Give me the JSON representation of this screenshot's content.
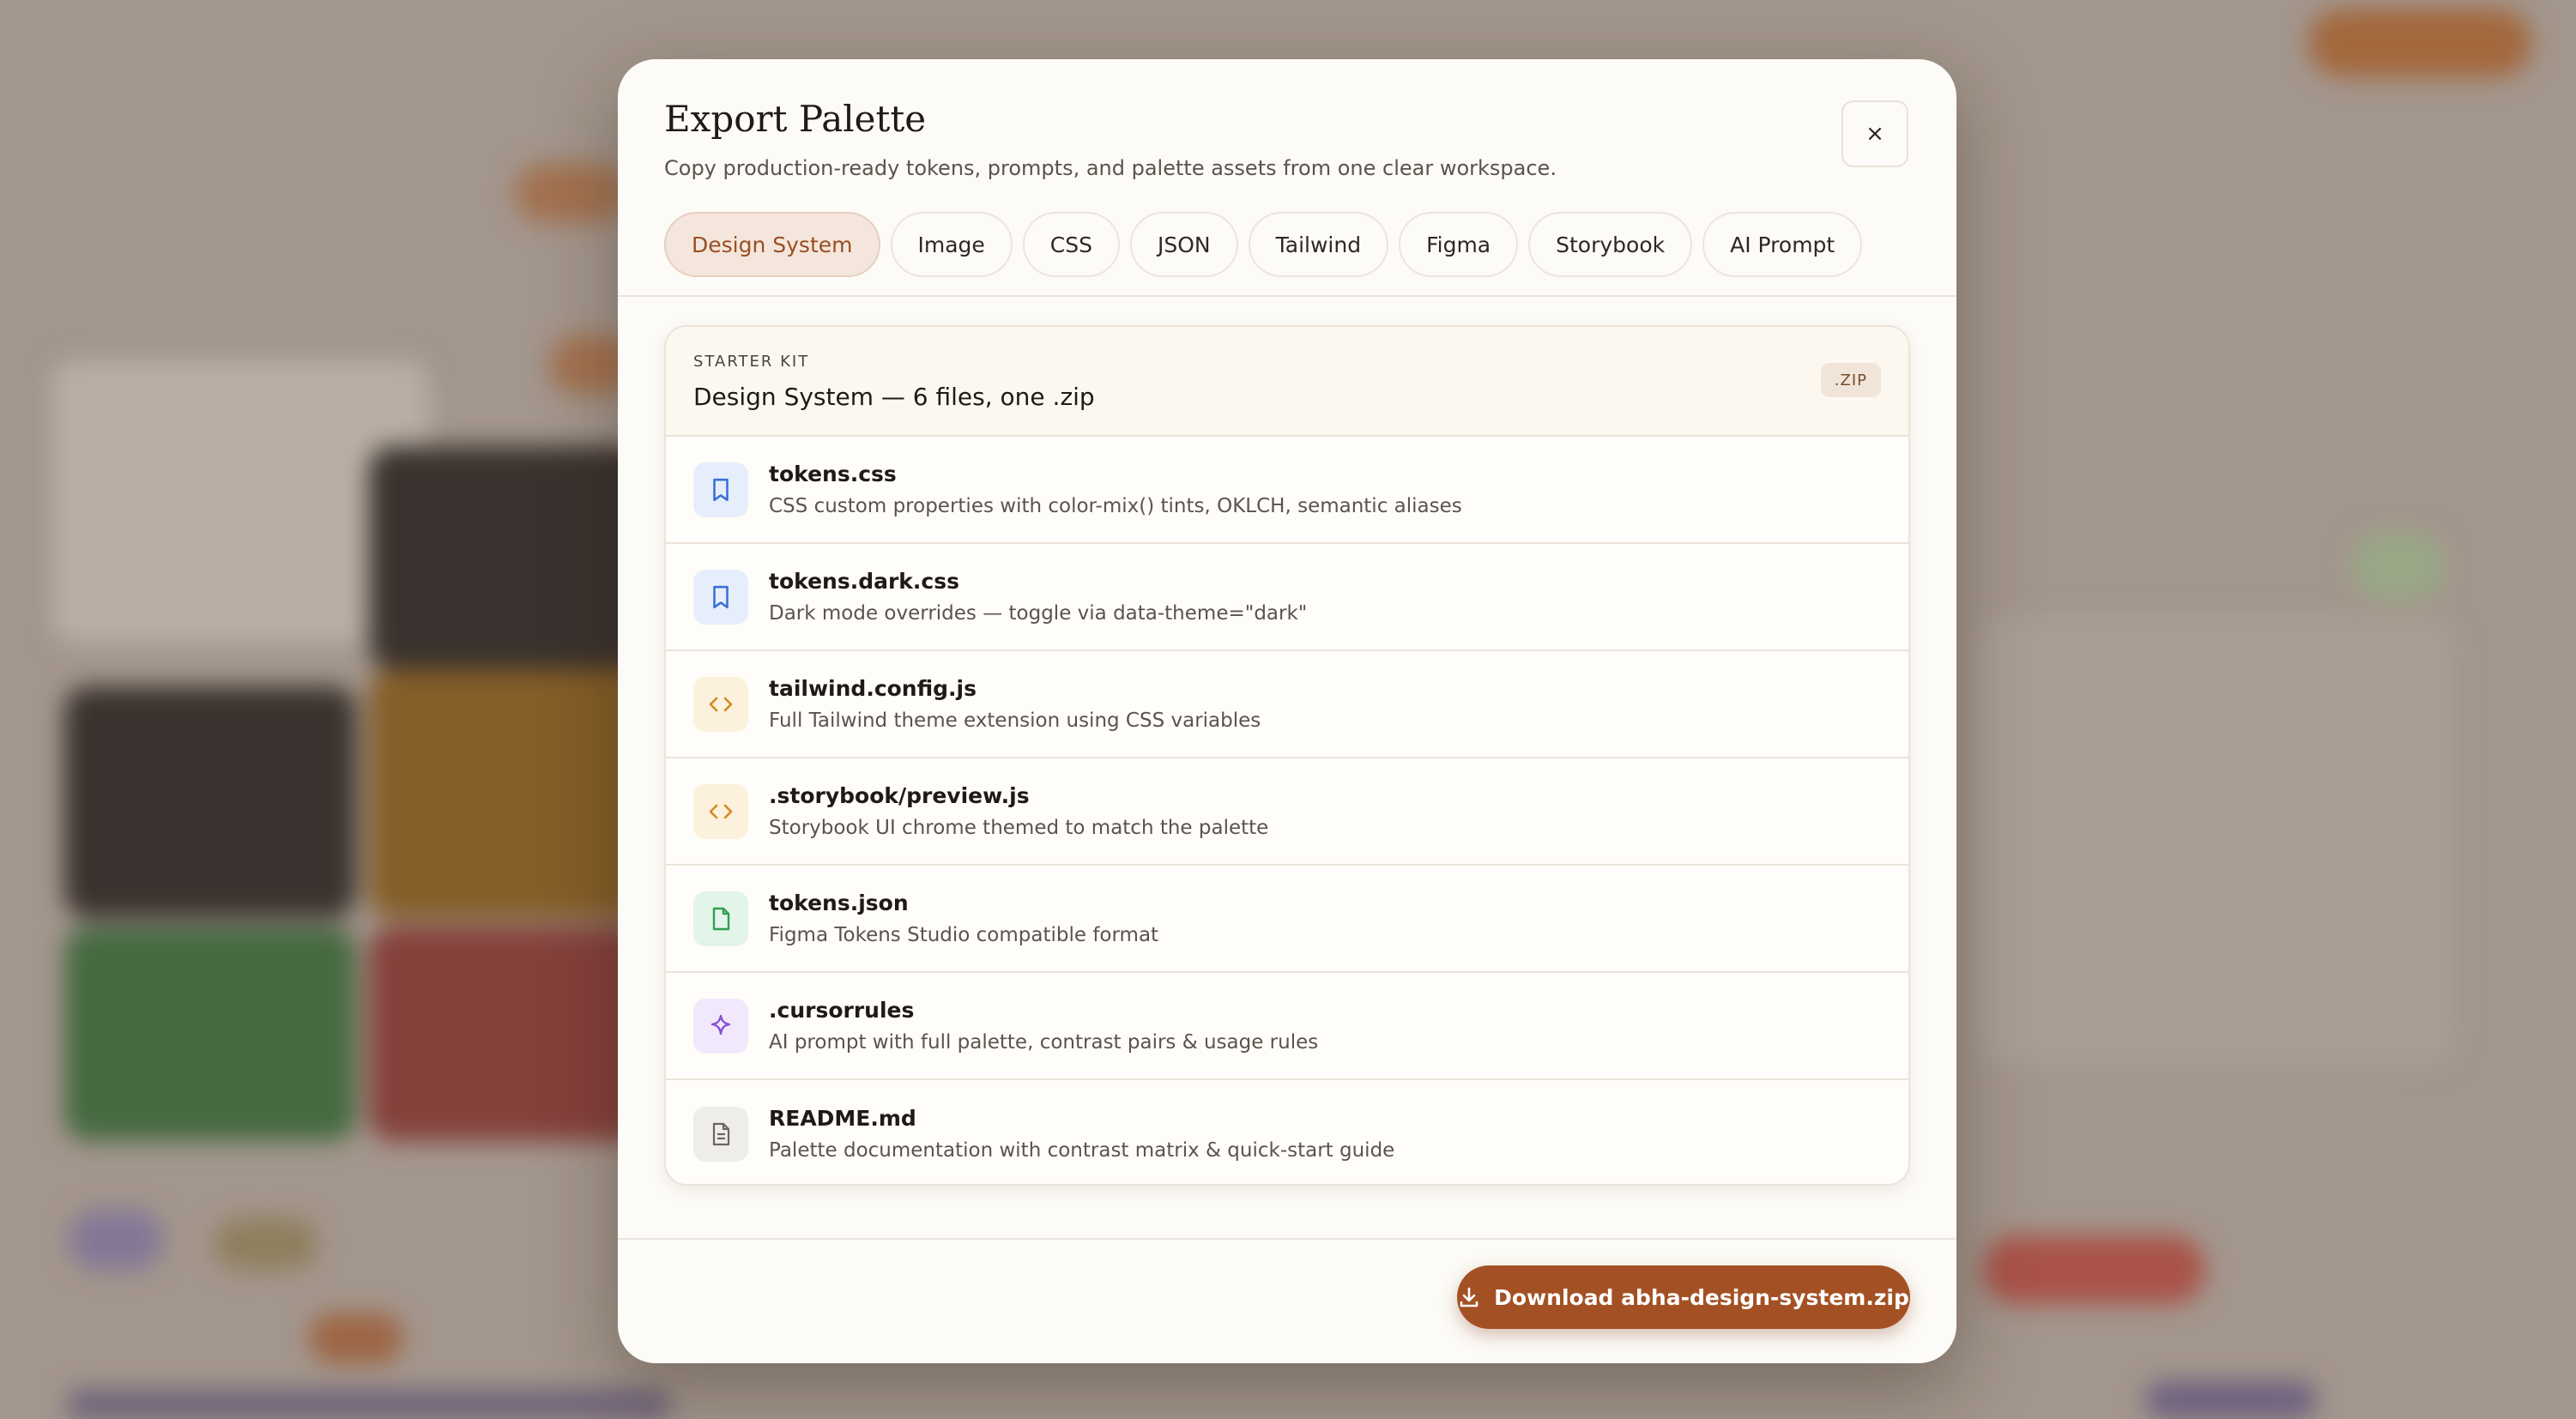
{
  "modal": {
    "title": "Export Palette",
    "subtitle": "Copy production-ready tokens, prompts, and palette assets from one clear workspace.",
    "close_label": "×",
    "tabs": [
      {
        "label": "Design System"
      },
      {
        "label": "Image"
      },
      {
        "label": "CSS"
      },
      {
        "label": "JSON"
      },
      {
        "label": "Tailwind"
      },
      {
        "label": "Figma"
      },
      {
        "label": "Storybook"
      },
      {
        "label": "AI Prompt"
      }
    ],
    "active_tab": "Design System",
    "card": {
      "eyebrow": "STARTER KIT",
      "title": "Design System — 6 files, one .zip",
      "badge": ".ZIP",
      "files": [
        {
          "name": "tokens.css",
          "desc": "CSS custom properties with color-mix() tints, OKLCH, semantic aliases",
          "icon": "bookmark-icon"
        },
        {
          "name": "tokens.dark.css",
          "desc": "Dark mode overrides — toggle via data-theme=\"dark\"",
          "icon": "bookmark-icon"
        },
        {
          "name": "tailwind.config.js",
          "desc": "Full Tailwind theme extension using CSS variables",
          "icon": "code-icon"
        },
        {
          "name": ".storybook/preview.js",
          "desc": "Storybook UI chrome themed to match the palette",
          "icon": "code-icon"
        },
        {
          "name": "tokens.json",
          "desc": "Figma Tokens Studio compatible format",
          "icon": "file-icon"
        },
        {
          "name": ".cursorrules",
          "desc": "AI prompt with full palette, contrast pairs & usage rules",
          "icon": "sparkle-icon"
        },
        {
          "name": "README.md",
          "desc": "Palette documentation with contrast matrix & quick-start guide",
          "icon": "document-icon"
        }
      ]
    },
    "download_label": "Download abha-design-system.zip"
  },
  "colors": {
    "accent": "#a35124",
    "active_tab_bg": "#f4e6dc",
    "active_tab_text": "#9a4e23",
    "icon_blue": "#3b6fd8",
    "icon_amber": "#d08a1e",
    "icon_green": "#2f9e55",
    "icon_purple": "#8a4ed6",
    "icon_gray": "#6b6560"
  }
}
